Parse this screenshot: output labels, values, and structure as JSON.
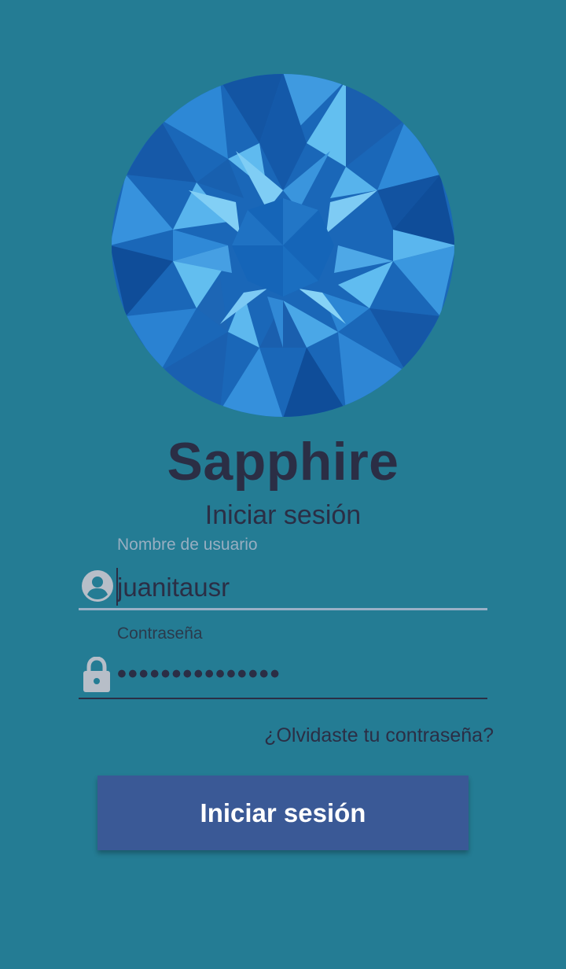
{
  "app": {
    "title": "Sapphire",
    "subtitle": "Iniciar sesión",
    "logo_icon": "sapphire-gem-icon"
  },
  "form": {
    "username": {
      "label": "Nombre de usuario",
      "value": "juanitausr",
      "icon": "account-circle-icon",
      "focused": true
    },
    "password": {
      "label": "Contraseña",
      "value": "•••••••••••••••",
      "icon": "lock-icon"
    },
    "forgot_password_link": "¿Olvidaste tu contraseña?",
    "submit_label": "Iniciar sesión"
  },
  "colors": {
    "background": "#247c94",
    "text_dark": "#2b2e45",
    "button": "#3a5996",
    "focused_line": "#9ab0c6",
    "icon_gray": "#b7bec8"
  }
}
